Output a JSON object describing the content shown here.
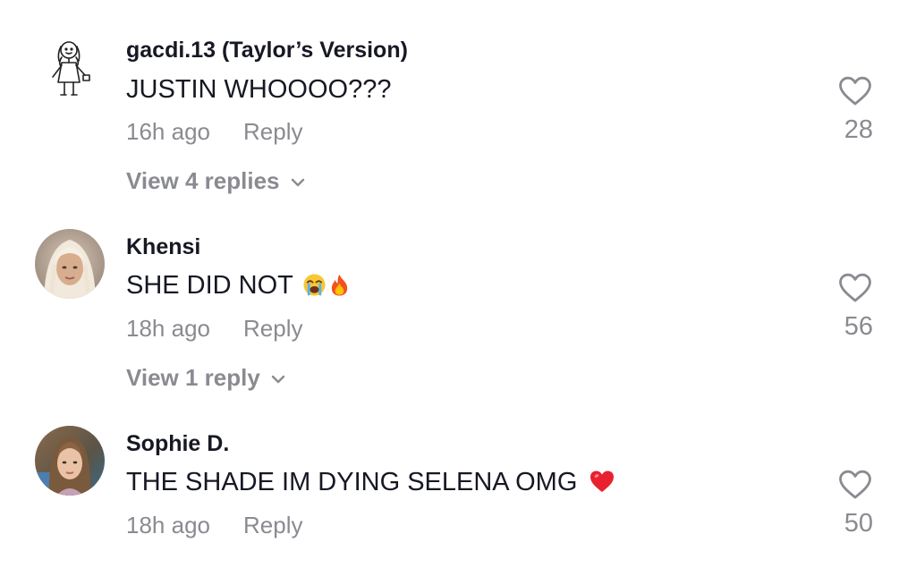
{
  "comments": [
    {
      "username": "gacdi.13 (Taylor’s Version)",
      "text": "JUSTIN WHOOOO???",
      "emojis": [],
      "time": "16h ago",
      "reply_label": "Reply",
      "likes": "28",
      "view_replies": "View 4 replies",
      "avatar_icon": "stick-figure-drawing",
      "liked": false
    },
    {
      "username": "Khensi",
      "text": "SHE DID NOT",
      "emojis": [
        "loudly-crying-face-emoji",
        "fire-emoji"
      ],
      "time": "18h ago",
      "reply_label": "Reply",
      "likes": "56",
      "view_replies": "View 1 reply",
      "avatar_icon": "profile-photo",
      "liked": false
    },
    {
      "username": "Sophie D.",
      "text": "THE SHADE IM DYING SELENA OMG",
      "emojis": [
        "red-heart-emoji"
      ],
      "time": "18h ago",
      "reply_label": "Reply",
      "likes": "50",
      "avatar_icon": "profile-photo",
      "liked": false
    }
  ],
  "colors": {
    "primary_text": "#161823",
    "secondary_text": "#8a8b91",
    "background": "#ffffff"
  }
}
